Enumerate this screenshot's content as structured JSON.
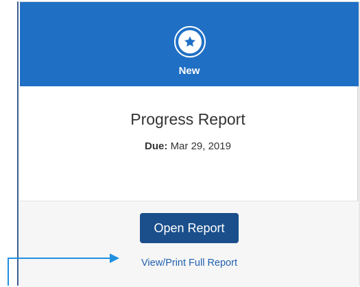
{
  "card": {
    "status": "New",
    "title": "Progress Report",
    "due_label": "Due:",
    "due_date": "Mar 29, 2019",
    "open_button": "Open Report",
    "print_link": "View/Print Full Report"
  },
  "icons": {
    "status_icon": "star-icon"
  },
  "colors": {
    "header": "#1f6fc5",
    "button": "#1a4f8b",
    "link": "#1f5fae",
    "annotation_arrow": "#1f8fe0"
  }
}
